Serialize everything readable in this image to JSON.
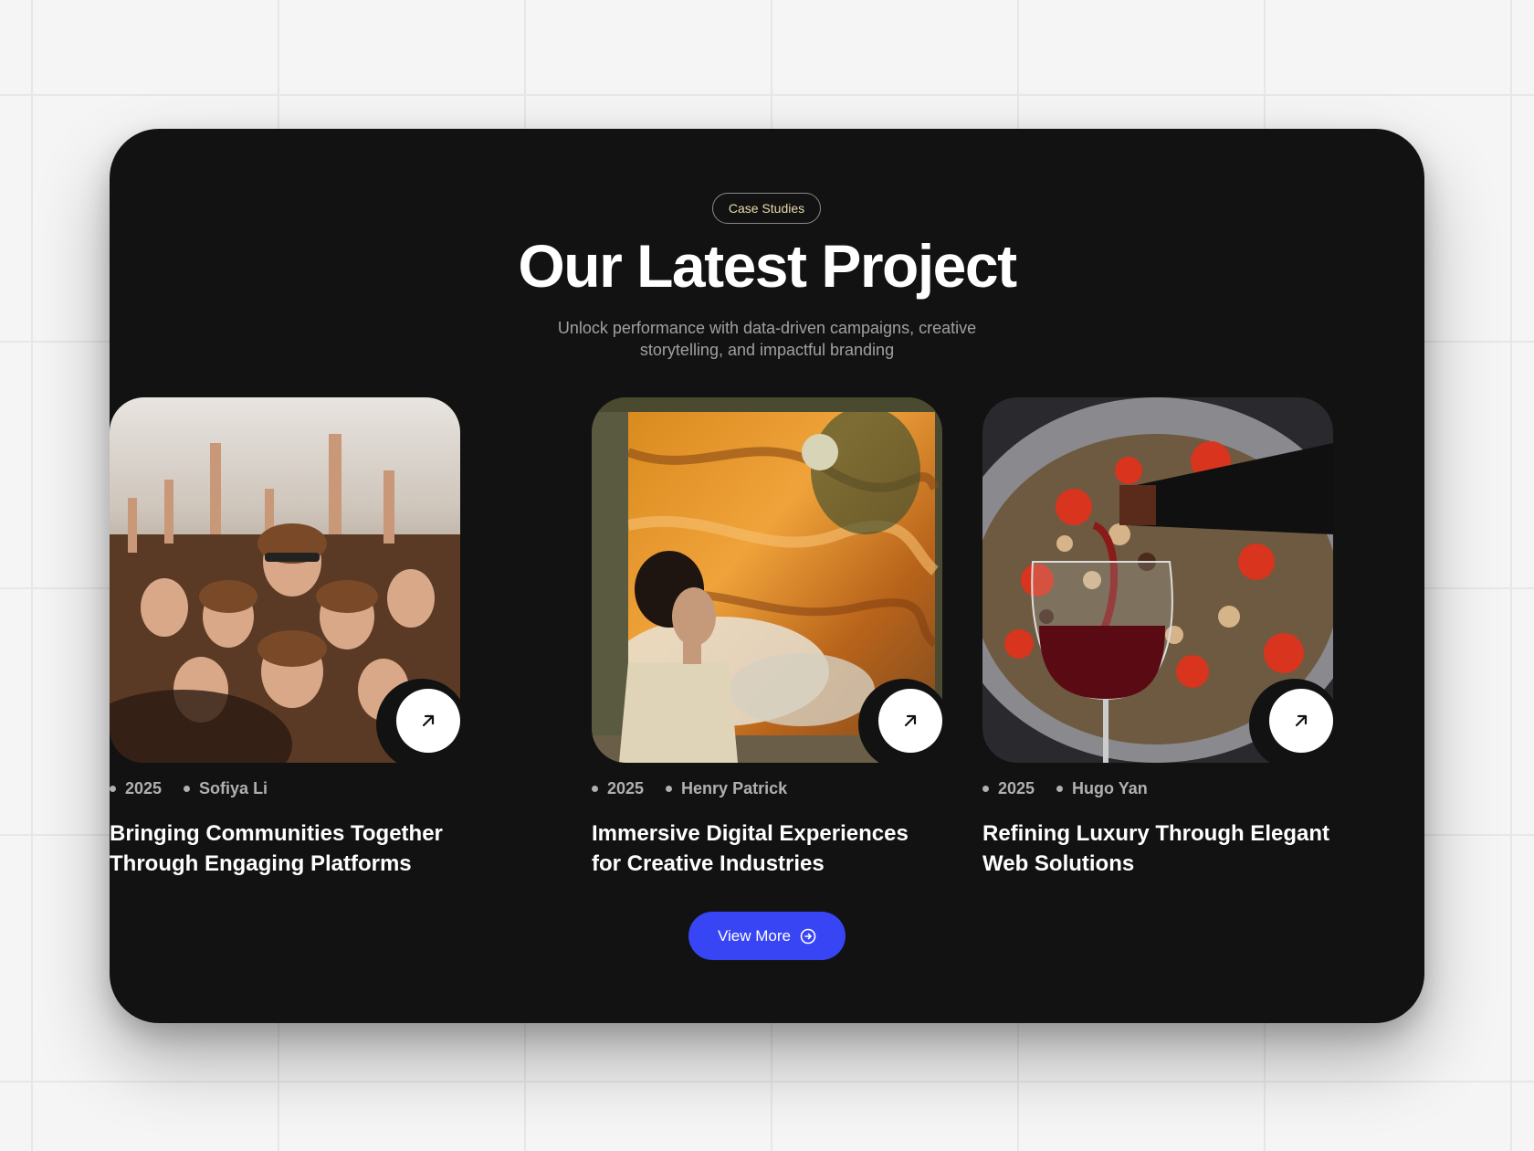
{
  "tag_label": "Case Studies",
  "title": "Our Latest Project",
  "subtitle": "Unlock performance with data-driven campaigns, creative storytelling, and impactful branding",
  "cards": [
    {
      "year": "2025",
      "author": "Henry Patrick",
      "title": "Immersive Digital Experiences for Creative Industries",
      "image_icon": "surreal-window-painting-image",
      "link_icon": "arrow-up-right-icon"
    },
    {
      "year": "2025",
      "author": "Hugo Yan",
      "title": "Refining Luxury Through Elegant Web Solutions",
      "image_icon": "wine-pour-food-image",
      "link_icon": "arrow-up-right-icon"
    },
    {
      "year": "2025",
      "author": "Sofiya Li",
      "title": "Bringing Communities Together Through Engaging Platforms",
      "image_icon": "concert-crowd-image",
      "link_icon": "arrow-up-right-icon"
    }
  ],
  "view_more_label": "View More",
  "colors": {
    "panel": "#121212",
    "accent": "#3845f5",
    "tag_text": "#e8d9a8",
    "background": "#f5f5f5"
  }
}
